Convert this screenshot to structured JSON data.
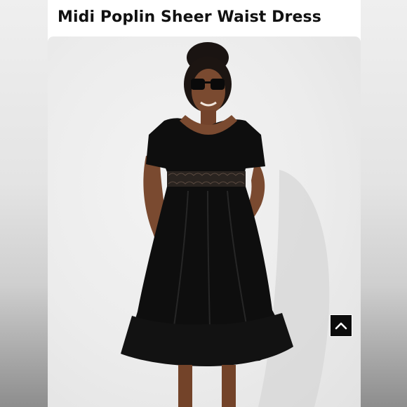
{
  "product": {
    "title": "Midi Poplin Sheer Waist Dress"
  },
  "photo": {
    "alt": "Model wearing black midi poplin dress with sheer lace waist",
    "dress_color": "#0e0e0e",
    "background_color": "#ececec"
  },
  "controls": {
    "back_to_top_icon": "chevron-up-icon"
  }
}
